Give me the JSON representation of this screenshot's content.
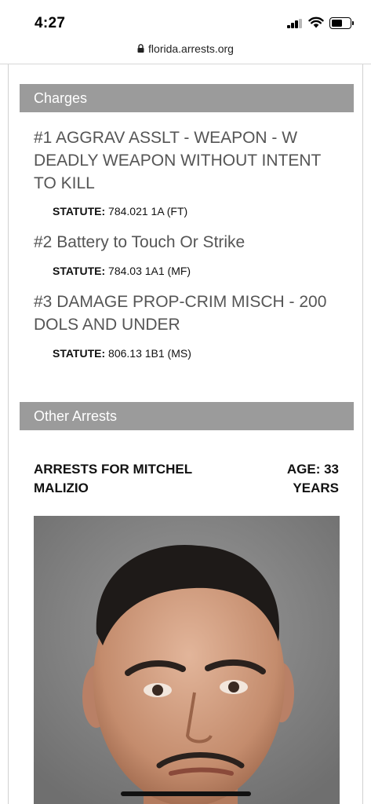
{
  "status_bar": {
    "time": "4:27"
  },
  "browser": {
    "url": "florida.arrests.org"
  },
  "charges_section": {
    "title": "Charges",
    "statute_label": "STATUTE:",
    "charges": [
      {
        "title": "#1 AGGRAV ASSLT - WEAPON - W DEADLY WEAPON WITHOUT INTENT TO KILL",
        "statute": "784.021 1A (FT)"
      },
      {
        "title": "#2 Battery to Touch Or Strike",
        "statute": "784.03 1A1 (MF)"
      },
      {
        "title": "#3 DAMAGE PROP-CRIM MISCH - 200 DOLS AND UNDER",
        "statute": "806.13 1B1 (MS)"
      }
    ]
  },
  "other_arrests_section": {
    "title": "Other Arrests",
    "arrests_for": "ARRESTS FOR MITCHEL MALIZIO",
    "age": "AGE: 33 YEARS"
  },
  "colors": {
    "header_bg": "#9b9b9b",
    "charge_text": "#555555"
  },
  "icons": [
    "signal-icon",
    "wifi-icon",
    "battery-icon",
    "lock-icon"
  ]
}
